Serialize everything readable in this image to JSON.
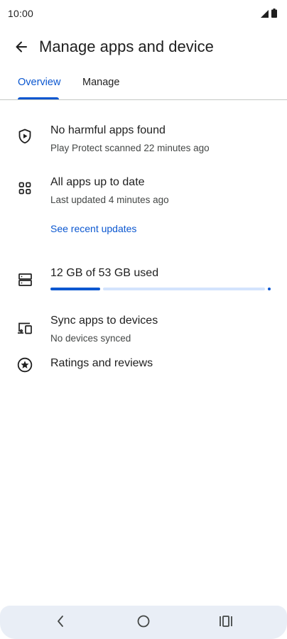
{
  "status_bar": {
    "time": "10:00",
    "icons": [
      "signal-icon",
      "battery-icon"
    ]
  },
  "app_bar": {
    "title": "Manage apps and device",
    "back_icon": "arrow-back-icon"
  },
  "tabs": [
    {
      "label": "Overview",
      "active": true
    },
    {
      "label": "Manage",
      "active": false
    }
  ],
  "overview": {
    "protect": {
      "icon": "play-protect-shield-icon",
      "title": "No harmful apps found",
      "subtitle": "Play Protect scanned 22 minutes ago"
    },
    "updates": {
      "icon": "apps-grid-icon",
      "title": "All apps up to date",
      "subtitle": "Last updated 4 minutes ago",
      "link": "See recent updates"
    },
    "storage": {
      "icon": "storage-icon",
      "title": "12 GB of 53 GB used",
      "used_gb": 12,
      "total_gb": 53
    },
    "sync": {
      "icon": "devices-icon",
      "title": "Sync apps to devices",
      "subtitle": "No devices synced"
    },
    "ratings": {
      "icon": "star-circle-icon",
      "title": "Ratings and reviews"
    }
  },
  "nav_bar": {
    "buttons": [
      "back-nav-icon",
      "home-nav-icon",
      "recents-nav-icon"
    ]
  },
  "colors": {
    "accent": "#0b57d0",
    "track": "#d3e3fd",
    "nav_bg": "#e9eef6",
    "text": "#1f1f1f",
    "secondary_text": "#444746"
  }
}
